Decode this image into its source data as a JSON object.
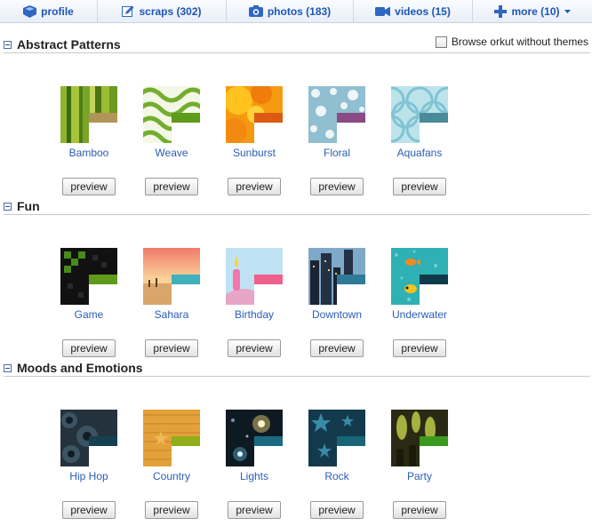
{
  "tabs": [
    {
      "label": "profile",
      "icon": "profile-box-icon"
    },
    {
      "label": "scraps (302)",
      "icon": "scraps-pencil-icon"
    },
    {
      "label": "photos (183)",
      "icon": "camera-icon"
    },
    {
      "label": "videos (15)",
      "icon": "video-camera-icon"
    },
    {
      "label": "more (10)",
      "icon": "plus-icon"
    }
  ],
  "browse_without_themes": {
    "label": "Browse orkut without themes",
    "checked": false
  },
  "preview_label": "preview",
  "sections": [
    {
      "title": "Abstract Patterns",
      "themes": [
        {
          "name": "Bamboo",
          "swatch": "#b19558"
        },
        {
          "name": "Weave",
          "swatch": "#5e9a1c"
        },
        {
          "name": "Sunburst",
          "swatch": "#dd5a12"
        },
        {
          "name": "Floral",
          "swatch": "#8a4a86"
        },
        {
          "name": "Aquafans",
          "swatch": "#4b8a99"
        }
      ]
    },
    {
      "title": "Fun",
      "themes": [
        {
          "name": "Game",
          "swatch": "#5f9a1a"
        },
        {
          "name": "Sahara",
          "swatch": "#3fb1bd"
        },
        {
          "name": "Birthday",
          "swatch": "#ef5f8c"
        },
        {
          "name": "Downtown",
          "swatch": "#2f7a97"
        },
        {
          "name": "Underwater",
          "swatch": "#0f3a4c"
        }
      ]
    },
    {
      "title": "Moods and Emotions",
      "themes": [
        {
          "name": "Hip Hop",
          "swatch": "#14404f"
        },
        {
          "name": "Country",
          "swatch": "#8fae1a"
        },
        {
          "name": "Lights",
          "swatch": "#1c6a82"
        },
        {
          "name": "Rock",
          "swatch": "#1a6478"
        },
        {
          "name": "Party",
          "swatch": "#3a9a1e"
        }
      ]
    }
  ]
}
